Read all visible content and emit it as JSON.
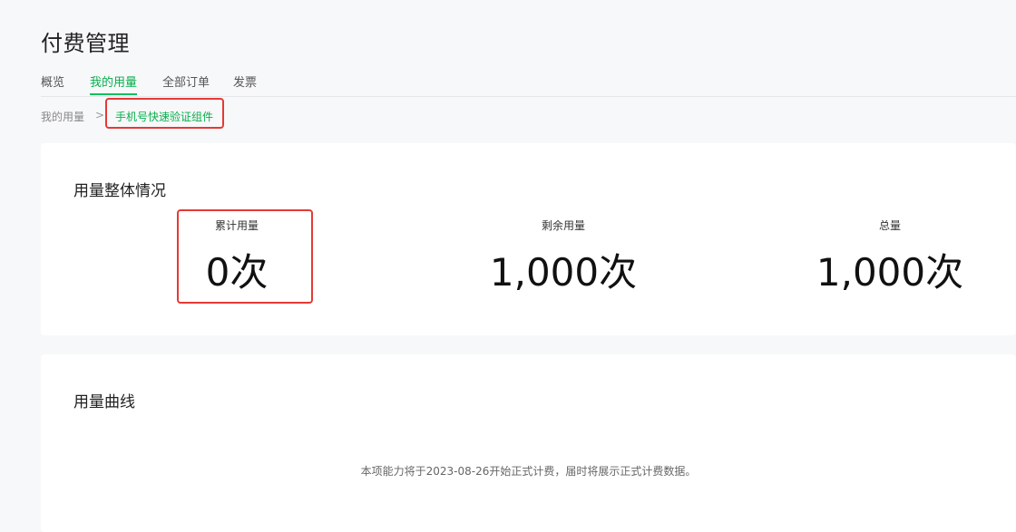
{
  "header": {
    "title": "付费管理"
  },
  "tabs": [
    {
      "label": "概览"
    },
    {
      "label": "我的用量"
    },
    {
      "label": "全部订单"
    },
    {
      "label": "发票"
    }
  ],
  "breadcrumb": {
    "root": "我的用量",
    "separator": ">",
    "current": "手机号快速验证组件"
  },
  "overview": {
    "title": "用量整体情况",
    "stats": [
      {
        "label": "累计用量",
        "value": "0次"
      },
      {
        "label": "剩余用量",
        "value": "1,000次"
      },
      {
        "label": "总量",
        "value": "1,000次"
      }
    ]
  },
  "curve": {
    "title": "用量曲线",
    "empty_message": "本项能力将于2023-08-26开始正式计费，届时将展示正式计费数据。"
  },
  "colors": {
    "accent": "#07c160",
    "highlight": "#e53935",
    "background": "#f7f8fa"
  }
}
